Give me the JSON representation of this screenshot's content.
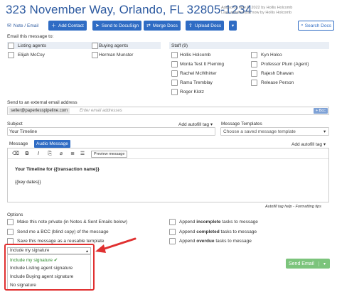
{
  "header": {
    "title": "323 November Way, Orlando, FL 32805-1234",
    "added_line": "Added on Nov 8, 2022 by Hollis Holcomb",
    "updated_line": "Last updated just now by Hollis Holcomb"
  },
  "toolbar": {
    "note_email": "Note / Email",
    "add_contact": "Add Contact",
    "send_docusign": "Send to DocuSign",
    "merge_docs": "Merge Docs",
    "upload_docs": "Upload Docs",
    "search_docs": "Search Docs"
  },
  "email_to": {
    "label": "Email this message to:",
    "groups": {
      "listing": "Listing agents",
      "buying": "Buying agents",
      "staff": "Staff (9)"
    },
    "listing_agents": [
      "Elijah McCoy"
    ],
    "buying_agents": [
      "Herman Munster"
    ],
    "staff_col1": [
      "Hollis Holcomb",
      "Monta Test It Fleming",
      "Rachel McWhirter",
      "Ramu Tremblay",
      "Roger Klotz"
    ],
    "staff_col2": [
      "Kyn Holco",
      "Professor Plum (Agent)",
      "Rajesh Dhawan",
      "Release Person"
    ]
  },
  "external": {
    "label": "Send to an external email address",
    "chip": "seller@paperlesspipeline.com",
    "placeholder": "Enter email addresses",
    "bcc": "+ Bcc"
  },
  "subject": {
    "label": "Subject",
    "value": "Your Timeline",
    "autofill": "Add autofill tag"
  },
  "templates": {
    "label": "Message Templates",
    "placeholder": "Choose a saved message template"
  },
  "message": {
    "label": "Message",
    "tab_audio": "Audio Message",
    "autofill": "Add autofill tag",
    "preview": "Preview message",
    "line1": "Your Timeline for {{transaction name}}",
    "line2": "{{key dates}}",
    "help": "Autofill tag help",
    "formatting": "Formatting tips"
  },
  "options": {
    "label": "Options",
    "left": [
      "Make this note private (in Notes & Sent Emails below)",
      "Send me a BCC (blind copy) of the message",
      "Save this message as a reusable template"
    ],
    "right": [
      {
        "pre": "Append ",
        "bold": "incomplete",
        "post": " tasks to message"
      },
      {
        "pre": "Append ",
        "bold": "completed",
        "post": " tasks to message"
      },
      {
        "pre": "Append ",
        "bold": "overdue",
        "post": " tasks to message"
      }
    ]
  },
  "signature": {
    "selected": "Include my signature",
    "options": [
      "Include my signature",
      "Include Listing agent signature",
      "Include Buying agent signature",
      "No signature"
    ]
  },
  "send": {
    "label": "Send Email"
  },
  "colors": {
    "accent": "#2f6cc4",
    "title": "#2d5aa0",
    "send": "#7cc47c",
    "highlight": "#e03030"
  }
}
